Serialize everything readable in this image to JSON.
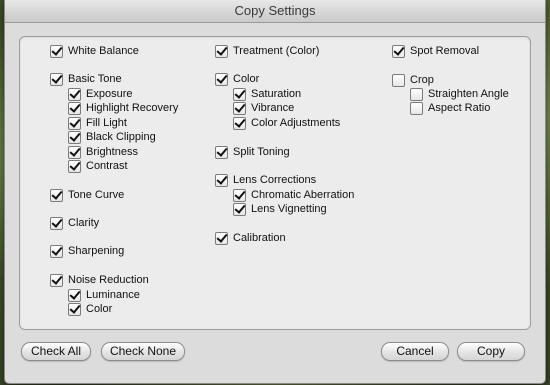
{
  "window": {
    "title": "Copy Settings"
  },
  "col1": {
    "white_balance": "White Balance",
    "basic_tone": "Basic Tone",
    "exposure": "Exposure",
    "highlight_recovery": "Highlight Recovery",
    "fill_light": "Fill Light",
    "black_clipping": "Black Clipping",
    "brightness": "Brightness",
    "contrast": "Contrast",
    "tone_curve": "Tone Curve",
    "clarity": "Clarity",
    "sharpening": "Sharpening",
    "noise_reduction": "Noise Reduction",
    "luminance": "Luminance",
    "color": "Color"
  },
  "col2": {
    "treatment": "Treatment (Color)",
    "color": "Color",
    "saturation": "Saturation",
    "vibrance": "Vibrance",
    "color_adjustments": "Color Adjustments",
    "split_toning": "Split Toning",
    "lens_corrections": "Lens Corrections",
    "chromatic_aberration": "Chromatic Aberration",
    "lens_vignetting": "Lens Vignetting",
    "calibration": "Calibration"
  },
  "col3": {
    "spot_removal": "Spot Removal",
    "crop": "Crop",
    "straighten_angle": "Straighten Angle",
    "aspect_ratio": "Aspect Ratio"
  },
  "checked": {
    "white_balance": true,
    "basic_tone": true,
    "exposure": true,
    "highlight_recovery": true,
    "fill_light": true,
    "black_clipping": true,
    "brightness": true,
    "contrast": true,
    "tone_curve": true,
    "clarity": true,
    "sharpening": true,
    "noise_reduction": true,
    "luminance": true,
    "nr_color": true,
    "treatment": true,
    "color": true,
    "saturation": true,
    "vibrance": true,
    "color_adjustments": true,
    "split_toning": true,
    "lens_corrections": true,
    "chromatic_aberration": true,
    "lens_vignetting": true,
    "calibration": true,
    "spot_removal": true,
    "crop": false,
    "straighten_angle": false,
    "aspect_ratio": false
  },
  "buttons": {
    "check_all": "Check All",
    "check_none": "Check None",
    "cancel": "Cancel",
    "copy": "Copy"
  }
}
